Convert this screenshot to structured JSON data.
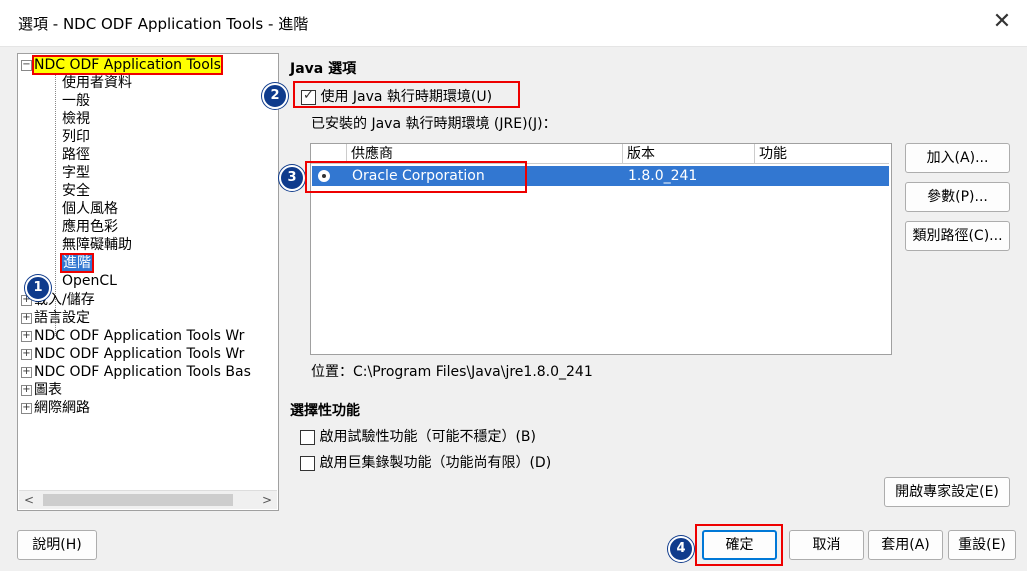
{
  "window": {
    "title": "選項 - NDC ODF Application Tools - 進階",
    "close_glyph": "✕"
  },
  "tree": {
    "root": "NDC ODF Application Tools",
    "root_expander": "−",
    "children": [
      "使用者資料",
      "一般",
      "檢視",
      "列印",
      "路徑",
      "字型",
      "安全",
      "個人風格",
      "應用色彩",
      "無障礙輔助",
      "進階",
      "OpenCL"
    ],
    "groups": [
      "載入/儲存",
      "語言設定",
      "NDC ODF Application Tools Wr",
      "NDC ODF Application Tools Wr",
      "NDC ODF Application Tools Bas",
      "圖表",
      "網際網路"
    ],
    "group_expander": "+",
    "scroll_left": "<",
    "scroll_right": ">"
  },
  "java": {
    "section_title": "Java 選項",
    "use_jre_label": "使用 Java 執行時期環境(U)",
    "use_jre_checked": true,
    "installed_label": "已安裝的 Java 執行時期環境 (JRE)(J)：",
    "table_headers": [
      "供應商",
      "版本",
      "功能"
    ],
    "rows": [
      {
        "vendor": "Oracle Corporation",
        "version": "1.8.0_241",
        "feature": ""
      }
    ],
    "location": "位置：C:\\Program Files\\Java\\jre1.8.0_241",
    "buttons": {
      "add": "加入(A)...",
      "params": "參數(P)...",
      "classpath": "類別路徑(C)..."
    }
  },
  "optional": {
    "section_title": "選擇性功能",
    "experimental_label": "啟用試驗性功能（可能不穩定）(B)",
    "macro_label": "啟用巨集錄製功能（功能尚有限）(D)",
    "expert_button": "開啟專家設定(E)"
  },
  "footer": {
    "help": "說明(H)",
    "ok": "確定",
    "cancel": "取消",
    "apply": "套用(A)",
    "reset": "重設(E)"
  },
  "badges": [
    "1",
    "2",
    "3",
    "4"
  ],
  "colors": {
    "selection": "#3277d1",
    "annotation_red": "#e00000",
    "badge_blue": "#0f3b8c",
    "highlight_yellow": "#ffff00"
  }
}
